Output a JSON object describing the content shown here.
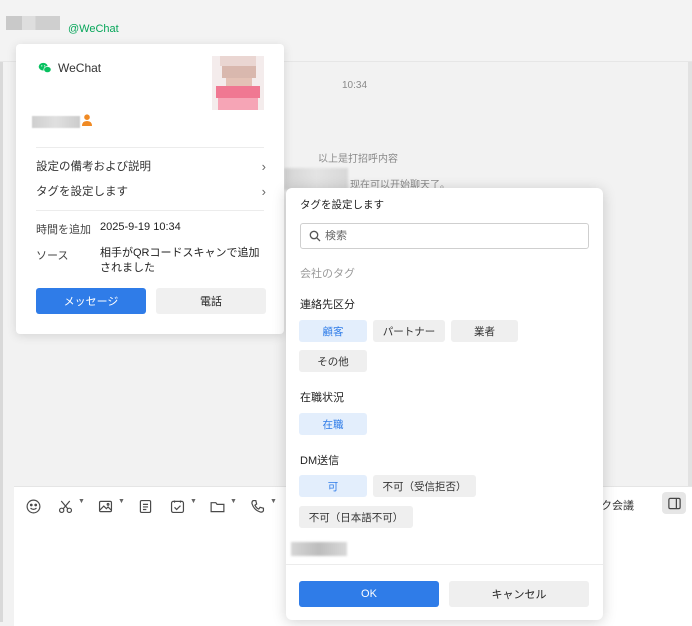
{
  "header": {
    "account_tag": "@WeChat"
  },
  "chat": {
    "timestamp": "10:34",
    "system_messages": [
      "以上是打招呼内容",
      "现在可以开始聊天了。"
    ]
  },
  "toolbar": {
    "quick_meeting_label": "ック会議",
    "icons": [
      "emoji-icon",
      "scissors-icon",
      "image-icon",
      "document-icon",
      "checkbox-icon",
      "folder-icon",
      "phone-icon"
    ]
  },
  "profile_card": {
    "source_label": "WeChat",
    "menu": [
      {
        "label": "設定の備考および説明"
      },
      {
        "label": "タグを設定します"
      }
    ],
    "fields": [
      {
        "label": "時間を追加",
        "value": "2025-9-19 10:34"
      },
      {
        "label": "ソース",
        "value_line1": "相手がQRコードスキャンで追加",
        "value_line2": "されました"
      }
    ],
    "message_button": "メッセージ",
    "call_button": "電話",
    "colors": {
      "primary": "#2f7ce8",
      "wechat_green": "#07c160",
      "person_icon": "#f08a24"
    }
  },
  "tag_popup": {
    "title": "タグを設定します",
    "search_placeholder": "検索",
    "company_tags_label": "会社のタグ",
    "groups": [
      {
        "title": "連絡先区分",
        "tags": [
          {
            "label": "顧客",
            "selected": true
          },
          {
            "label": "パートナー",
            "selected": false
          },
          {
            "label": "業者",
            "selected": false
          },
          {
            "label": "その他",
            "selected": false
          }
        ]
      },
      {
        "title": "在職状況",
        "tags": [
          {
            "label": "在職",
            "selected": true
          }
        ]
      },
      {
        "title": "DM送信",
        "tags": [
          {
            "label": "可",
            "selected": true
          },
          {
            "label": "不可（受信拒否）",
            "selected": false
          },
          {
            "label": "不可（日本語不可）",
            "selected": false
          }
        ]
      }
    ],
    "ok_button": "OK",
    "cancel_button": "キャンセル",
    "colors": {
      "selected_bg": "#e3eefc",
      "selected_text": "#2f7ce8",
      "chip_bg": "#efefef"
    }
  }
}
